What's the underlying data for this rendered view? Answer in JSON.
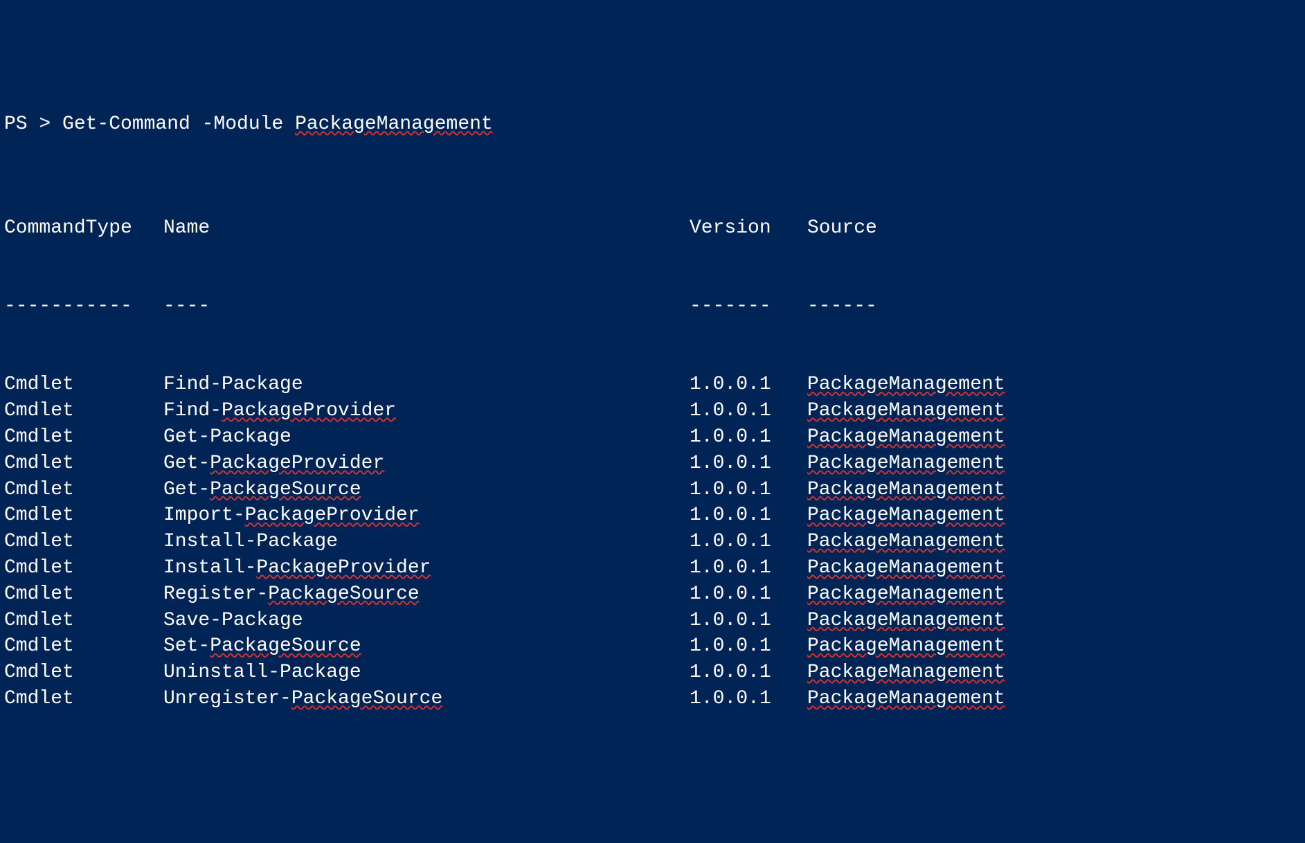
{
  "prompt": {
    "prefix": "PS > Get-Command -Module ",
    "arg": "PackageManagement"
  },
  "headers": {
    "commandType": "CommandType",
    "name": "Name",
    "version": "Version",
    "source": "Source"
  },
  "dashes": {
    "commandType": "-----------",
    "name": "----",
    "version": "-------",
    "source": "------"
  },
  "rows": [
    {
      "type": "Cmdlet",
      "namePlain": "Find-Package",
      "nameSquiggle": "",
      "version": "1.0.0.1",
      "source": "PackageManagement"
    },
    {
      "type": "Cmdlet",
      "namePlain": "Find-",
      "nameSquiggle": "PackageProvider",
      "version": "1.0.0.1",
      "source": "PackageManagement"
    },
    {
      "type": "Cmdlet",
      "namePlain": "Get-Package",
      "nameSquiggle": "",
      "version": "1.0.0.1",
      "source": "PackageManagement"
    },
    {
      "type": "Cmdlet",
      "namePlain": "Get-",
      "nameSquiggle": "PackageProvider",
      "version": "1.0.0.1",
      "source": "PackageManagement"
    },
    {
      "type": "Cmdlet",
      "namePlain": "Get-",
      "nameSquiggle": "PackageSource",
      "version": "1.0.0.1",
      "source": "PackageManagement"
    },
    {
      "type": "Cmdlet",
      "namePlain": "Import-",
      "nameSquiggle": "PackageProvider",
      "version": "1.0.0.1",
      "source": "PackageManagement"
    },
    {
      "type": "Cmdlet",
      "namePlain": "Install-Package",
      "nameSquiggle": "",
      "version": "1.0.0.1",
      "source": "PackageManagement"
    },
    {
      "type": "Cmdlet",
      "namePlain": "Install-",
      "nameSquiggle": "PackageProvider",
      "version": "1.0.0.1",
      "source": "PackageManagement"
    },
    {
      "type": "Cmdlet",
      "namePlain": "Register-",
      "nameSquiggle": "PackageSource",
      "version": "1.0.0.1",
      "source": "PackageManagement"
    },
    {
      "type": "Cmdlet",
      "namePlain": "Save-Package",
      "nameSquiggle": "",
      "version": "1.0.0.1",
      "source": "PackageManagement"
    },
    {
      "type": "Cmdlet",
      "namePlain": "Set-",
      "nameSquiggle": "PackageSource",
      "version": "1.0.0.1",
      "source": "PackageManagement"
    },
    {
      "type": "Cmdlet",
      "namePlain": "Uninstall-Package",
      "nameSquiggle": "",
      "version": "1.0.0.1",
      "source": "PackageManagement"
    },
    {
      "type": "Cmdlet",
      "namePlain": "Unregister-",
      "nameSquiggle": "PackageSource",
      "version": "1.0.0.1",
      "source": "PackageManagement"
    }
  ]
}
